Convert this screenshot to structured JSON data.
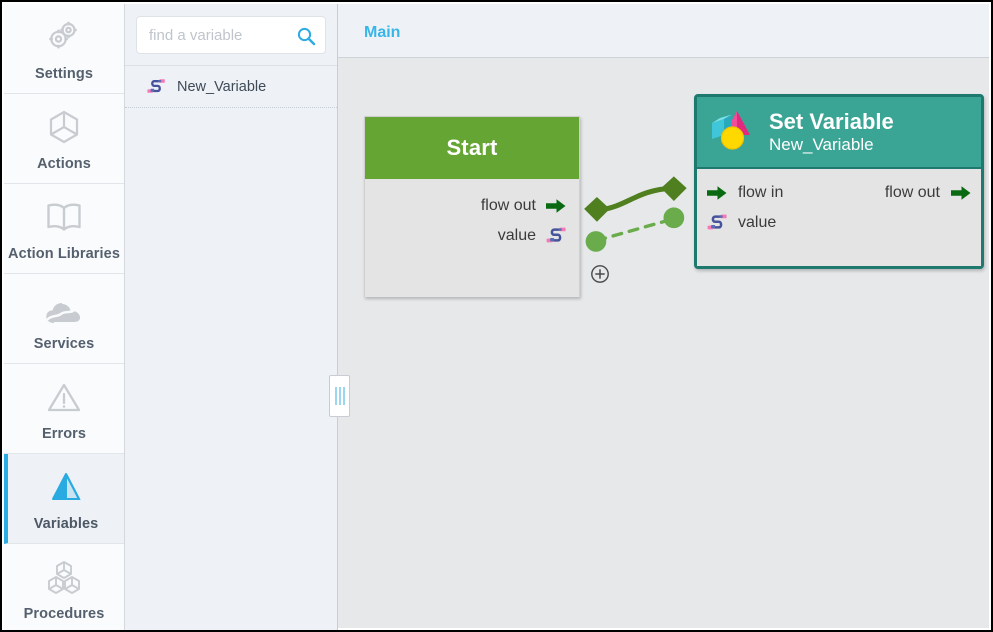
{
  "sidebar": {
    "items": [
      {
        "label": "Settings",
        "icon": "gears-icon",
        "selected": false
      },
      {
        "label": "Actions",
        "icon": "cube-icon",
        "selected": false
      },
      {
        "label": "Action Libraries",
        "icon": "book-icon",
        "selected": false
      },
      {
        "label": "Services",
        "icon": "cloud-icon",
        "selected": false
      },
      {
        "label": "Errors",
        "icon": "warning-icon",
        "selected": false
      },
      {
        "label": "Variables",
        "icon": "pyramid-icon",
        "selected": true
      },
      {
        "label": "Procedures",
        "icon": "blocks-icon",
        "selected": false
      }
    ],
    "accent_color": "#2bace2"
  },
  "variable_panel": {
    "search": {
      "placeholder": "find a variable",
      "value": "",
      "icon": "search-icon"
    },
    "variables": [
      {
        "name": "New_Variable",
        "icon": "variable-icon"
      }
    ]
  },
  "splitter": {
    "name": "panel-resize-handle"
  },
  "canvas": {
    "tabs": [
      {
        "label": "Main",
        "active": true
      }
    ],
    "background_color": "#e6e8ea",
    "add_button": {
      "icon": "plus-circle-icon"
    },
    "nodes": [
      {
        "id": "start",
        "title": "Start",
        "subtitle": "",
        "header_color": "#65a534",
        "ports": [
          {
            "label": "flow out",
            "icon": "flow-arrow-icon",
            "side": "out",
            "type": "flow"
          },
          {
            "label": "value",
            "icon": "variable-icon",
            "side": "out",
            "type": "value"
          }
        ]
      },
      {
        "id": "set-variable",
        "title": "Set Variable",
        "subtitle": "New_Variable",
        "header_color": "#3aa595",
        "border_color": "#1e7a6e",
        "icon": "shapes-icon",
        "ports": [
          {
            "label": "flow in",
            "icon": "flow-arrow-icon",
            "side": "in",
            "type": "flow"
          },
          {
            "label": "flow out",
            "icon": "flow-arrow-icon",
            "side": "out",
            "type": "flow"
          },
          {
            "label": "value",
            "icon": "variable-icon",
            "side": "in",
            "type": "value"
          }
        ]
      }
    ],
    "connections": [
      {
        "type": "flow",
        "style": "solid",
        "color": "#4f7f1e",
        "endpoint": "diamond"
      },
      {
        "type": "value",
        "style": "dashed",
        "color": "#6aab4c",
        "endpoint": "circle"
      }
    ]
  }
}
